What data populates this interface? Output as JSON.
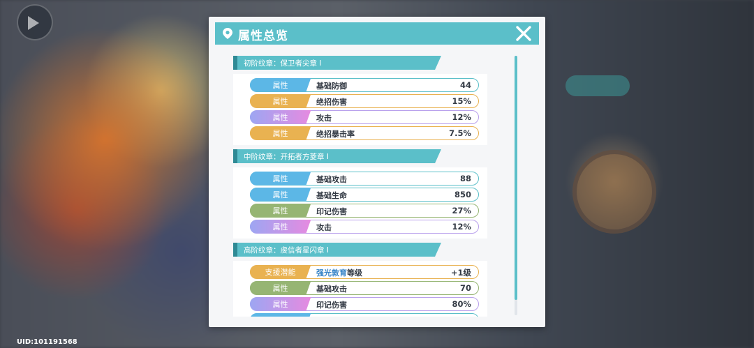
{
  "footer": {
    "uid": "UID:101191568"
  },
  "modal": {
    "title": "属性总览",
    "sections": [
      {
        "title": "初阶纹章：保卫者尖章 Ⅰ",
        "rows": [
          {
            "tag": "属性",
            "color": "blue",
            "name": "基础防御",
            "value": "44"
          },
          {
            "tag": "属性",
            "color": "orange",
            "name": "绝招伤害",
            "value": "15%"
          },
          {
            "tag": "属性",
            "color": "purple",
            "name": "攻击",
            "value": "12%"
          },
          {
            "tag": "属性",
            "color": "orange",
            "name": "绝招暴击率",
            "value": "7.5%"
          }
        ]
      },
      {
        "title": "中阶纹章：开拓者方菱章 Ⅰ",
        "rows": [
          {
            "tag": "属性",
            "color": "blue",
            "name": "基础攻击",
            "value": "88"
          },
          {
            "tag": "属性",
            "color": "blue",
            "name": "基础生命",
            "value": "850"
          },
          {
            "tag": "属性",
            "color": "green",
            "name": "印记伤害",
            "value": "27%"
          },
          {
            "tag": "属性",
            "color": "purple",
            "name": "攻击",
            "value": "12%"
          }
        ]
      },
      {
        "title": "高阶纹章：虔信者星闪章 Ⅰ",
        "rows": [
          {
            "tag": "支援潜能",
            "color": "orange",
            "name_highlight": "强光敦育",
            "name": "等级",
            "value": "+1级"
          },
          {
            "tag": "属性",
            "color": "green",
            "name": "基础攻击",
            "value": "70"
          },
          {
            "tag": "属性",
            "color": "purple",
            "name": "印记伤害",
            "value": "80%"
          },
          {
            "tag": "",
            "color": "blue",
            "name": "",
            "value": ""
          }
        ]
      }
    ]
  },
  "colors": {
    "accent": "#5bbfc9",
    "blue": "#5cb7e6",
    "orange": "#e9b251",
    "purple": "#b9a0ec",
    "green": "#96b573"
  }
}
